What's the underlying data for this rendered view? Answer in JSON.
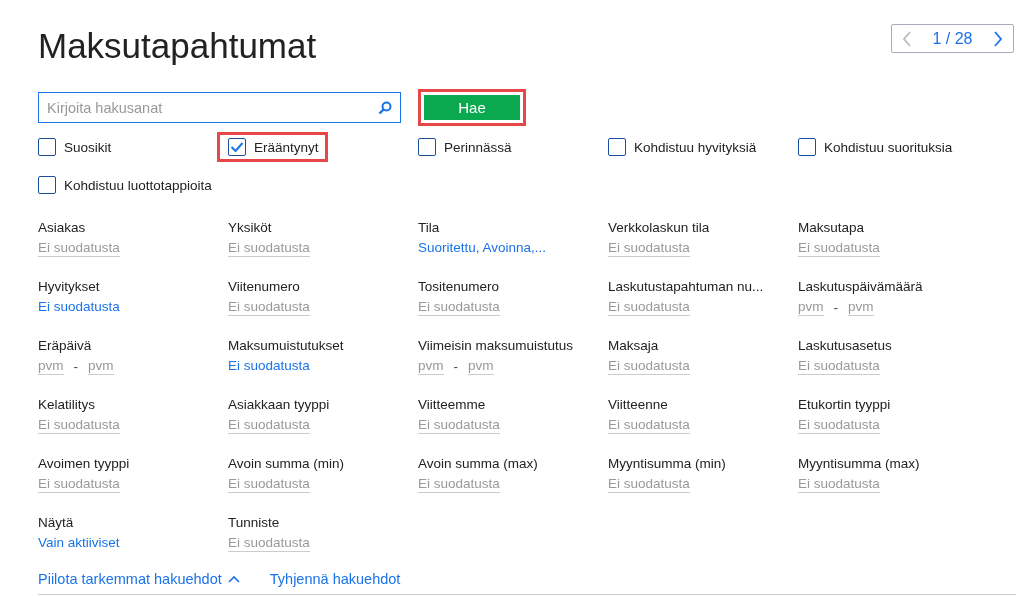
{
  "title": "Maksutapahtumat",
  "pager": {
    "text": "1 / 28",
    "prev_disabled": true,
    "next_disabled": false
  },
  "search": {
    "placeholder": "Kirjoita hakusanat",
    "button": "Hae",
    "button_highlighted": true
  },
  "checkboxes": [
    {
      "label": "Suosikit",
      "checked": false,
      "highlighted": false
    },
    {
      "label": "Erääntynyt",
      "checked": true,
      "highlighted": true
    },
    {
      "label": "Perinnässä",
      "checked": false,
      "highlighted": false
    },
    {
      "label": "Kohdistuu hyvityksiä",
      "checked": false,
      "highlighted": false
    },
    {
      "label": "Kohdistuu suorituksia",
      "checked": false,
      "highlighted": false
    },
    {
      "label": "Kohdistuu luottotappioita",
      "checked": false,
      "highlighted": false
    }
  ],
  "filters": [
    {
      "label": "Asiakas",
      "kind": "value",
      "value": "Ei suodatusta",
      "active": false
    },
    {
      "label": "Yksiköt",
      "kind": "value",
      "value": "Ei suodatusta",
      "active": false
    },
    {
      "label": "Tila",
      "kind": "value",
      "value": "Suoritettu, Avoinna,...",
      "active": true
    },
    {
      "label": "Verkkolaskun tila",
      "kind": "value",
      "value": "Ei suodatusta",
      "active": false
    },
    {
      "label": "Maksutapa",
      "kind": "value",
      "value": "Ei suodatusta",
      "active": false
    },
    {
      "label": "Hyvitykset",
      "kind": "value",
      "value": "Ei suodatusta",
      "active": true
    },
    {
      "label": "Viitenumero",
      "kind": "value",
      "value": "Ei suodatusta",
      "active": false
    },
    {
      "label": "Tositenumero",
      "kind": "value",
      "value": "Ei suodatusta",
      "active": false
    },
    {
      "label": "Laskutustapahtuman nu...",
      "kind": "value",
      "value": "Ei suodatusta",
      "active": false
    },
    {
      "label": "Laskutuspäivämäärä",
      "kind": "date",
      "from": "pvm",
      "separator": "-",
      "to": "pvm"
    },
    {
      "label": "Eräpäivä",
      "kind": "date",
      "from": "pvm",
      "separator": "-",
      "to": "pvm"
    },
    {
      "label": "Maksumuistutukset",
      "kind": "value",
      "value": "Ei suodatusta",
      "active": true
    },
    {
      "label": "Viimeisin maksumuistutus",
      "kind": "date",
      "from": "pvm",
      "separator": "-",
      "to": "pvm"
    },
    {
      "label": "Maksaja",
      "kind": "value",
      "value": "Ei suodatusta",
      "active": false
    },
    {
      "label": "Laskutusasetus",
      "kind": "value",
      "value": "Ei suodatusta",
      "active": false
    },
    {
      "label": "Kelatilitys",
      "kind": "value",
      "value": "Ei suodatusta",
      "active": false
    },
    {
      "label": "Asiakkaan tyyppi",
      "kind": "value",
      "value": "Ei suodatusta",
      "active": false
    },
    {
      "label": "Viitteemme",
      "kind": "value",
      "value": "Ei suodatusta",
      "active": false
    },
    {
      "label": "Viitteenne",
      "kind": "value",
      "value": "Ei suodatusta",
      "active": false
    },
    {
      "label": "Etukortin tyyppi",
      "kind": "value",
      "value": "Ei suodatusta",
      "active": false
    },
    {
      "label": "Avoimen tyyppi",
      "kind": "value",
      "value": "Ei suodatusta",
      "active": false
    },
    {
      "label": "Avoin summa (min)",
      "kind": "value",
      "value": "Ei suodatusta",
      "active": false
    },
    {
      "label": "Avoin summa (max)",
      "kind": "value",
      "value": "Ei suodatusta",
      "active": false
    },
    {
      "label": "Myyntisumma (min)",
      "kind": "value",
      "value": "Ei suodatusta",
      "active": false
    },
    {
      "label": "Myyntisumma (max)",
      "kind": "value",
      "value": "Ei suodatusta",
      "active": false
    },
    {
      "label": "Näytä",
      "kind": "value",
      "value": "Vain aktiiviset",
      "active": true
    },
    {
      "label": "Tunniste",
      "kind": "value",
      "value": "Ei suodatusta",
      "active": false
    }
  ],
  "links": [
    {
      "label": "Piilota tarkemmat hakuehdot",
      "caret": true
    },
    {
      "label": "Tyhjennä hakuehdot",
      "caret": false
    }
  ]
}
